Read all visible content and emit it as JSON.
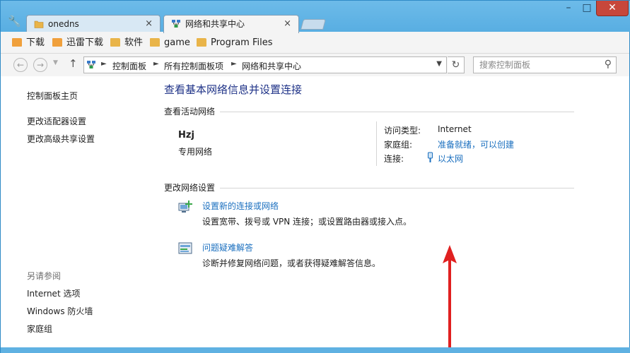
{
  "colors": {
    "accent_link": "#1a6fbf",
    "title_blue": "#1e3287",
    "window_frame": "#5fb1e2",
    "close_button": "#c7473b",
    "annotation_arrow": "#e02020"
  },
  "tabs": [
    {
      "label": "onedns",
      "icon": "folder-icon",
      "active": false
    },
    {
      "label": "网络和共享中心",
      "icon": "network-center-icon",
      "active": true
    }
  ],
  "tab_close_glyph": "×",
  "window_controls": {
    "minimize": "–",
    "maximize": "□",
    "close": "✕"
  },
  "bookmarks": [
    {
      "label": "下载",
      "icon": "download-folder-icon"
    },
    {
      "label": "迅雷下载",
      "icon": "download-folder-icon"
    },
    {
      "label": "软件",
      "icon": "folder-icon"
    },
    {
      "label": "game",
      "icon": "folder-icon"
    },
    {
      "label": "Program Files",
      "icon": "folder-icon"
    }
  ],
  "address": {
    "breadcrumbs": [
      "控制面板",
      "所有控制面板项",
      "网络和共享中心"
    ],
    "search_placeholder": "搜索控制面板"
  },
  "sidebar": {
    "home": "控制面板主页",
    "links": [
      "更改适配器设置",
      "更改高级共享设置"
    ],
    "see_also_heading": "另请参阅",
    "see_also": [
      "Internet 选项",
      "Windows 防火墙",
      "家庭组"
    ]
  },
  "main": {
    "title": "查看基本网络信息并设置连接",
    "active_networks_label": "查看活动网络",
    "network": {
      "name": "Hzj",
      "type": "专用网络",
      "access_type_label": "访问类型:",
      "access_type_value": "Internet",
      "homegroup_label": "家庭组:",
      "homegroup_value": "准备就绪，可以创建",
      "connections_label": "连接:",
      "connections_value": "以太网"
    },
    "change_settings_label": "更改网络设置",
    "tasks": [
      {
        "title": "设置新的连接或网络",
        "description": "设置宽带、拨号或 VPN 连接；或设置路由器或接入点。",
        "icon": "new-connection-icon"
      },
      {
        "title": "问题疑难解答",
        "description": "诊断并修复网络问题，或者获得疑难解答信息。",
        "icon": "troubleshoot-icon"
      }
    ]
  }
}
